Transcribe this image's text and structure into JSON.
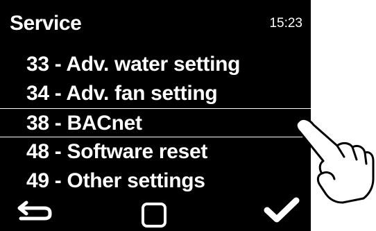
{
  "header": {
    "title": "Service",
    "time": "15:23"
  },
  "menu": {
    "items": [
      {
        "label": "33 - Adv. water setting"
      },
      {
        "label": "34 - Adv. fan setting"
      },
      {
        "label": "38 - BACnet",
        "selected": true
      },
      {
        "label": "48 - Software reset"
      },
      {
        "label": "49 - Other settings"
      }
    ]
  },
  "footer": {
    "buttons": [
      {
        "icon": "back-arrow-icon"
      },
      {
        "icon": "square-icon"
      },
      {
        "icon": "checkmark-icon"
      }
    ]
  },
  "colors": {
    "screen_background": "#000000",
    "text": "#ffffff"
  }
}
